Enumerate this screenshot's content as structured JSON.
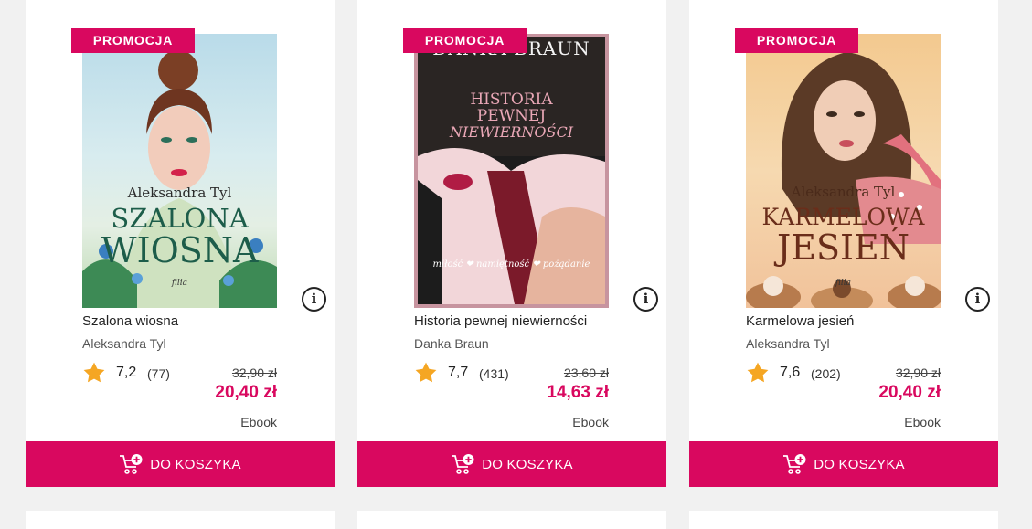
{
  "colors": {
    "accent": "#d9085f",
    "star": "#f5a623",
    "background": "#f1f1f1"
  },
  "products": [
    {
      "promo": "PROMOCJA",
      "cover": {
        "author": "Aleksandra Tyl",
        "line1": "SZALONA",
        "line2": "WIOSNA",
        "imprint": "filia"
      },
      "title": "Szalona wiosna",
      "author": "Aleksandra Tyl",
      "rating": "7,2",
      "votes": "(77)",
      "old_price": "32,90 zł",
      "price": "20,40 zł",
      "format": "Ebook",
      "button": "DO KOSZYKA"
    },
    {
      "promo": "PROMOCJA",
      "cover": {
        "author": "DANKA BRAUN",
        "line1": "HISTORIA",
        "line2": "PEWNEJ",
        "line3": "NIEWIERNOŚCI",
        "tagline": "miłość ❤ namiętność ❤ pożądanie"
      },
      "title": "Historia pewnej niewierności",
      "author": "Danka Braun",
      "rating": "7,7",
      "votes": "(431)",
      "old_price": "23,60 zł",
      "price": "14,63 zł",
      "format": "Ebook",
      "button": "DO KOSZYKA"
    },
    {
      "promo": "PROMOCJA",
      "cover": {
        "author": "Aleksandra Tyl",
        "line1": "KARMELOWA",
        "line2": "JESIEŃ",
        "imprint": "filia"
      },
      "title": "Karmelowa jesień",
      "author": "Aleksandra Tyl",
      "rating": "7,6",
      "votes": "(202)",
      "old_price": "32,90 zł",
      "price": "20,40 zł",
      "format": "Ebook",
      "button": "DO KOSZYKA"
    }
  ],
  "icons": {
    "info": "info-icon",
    "star": "star-icon",
    "cart": "cart-add-icon"
  }
}
